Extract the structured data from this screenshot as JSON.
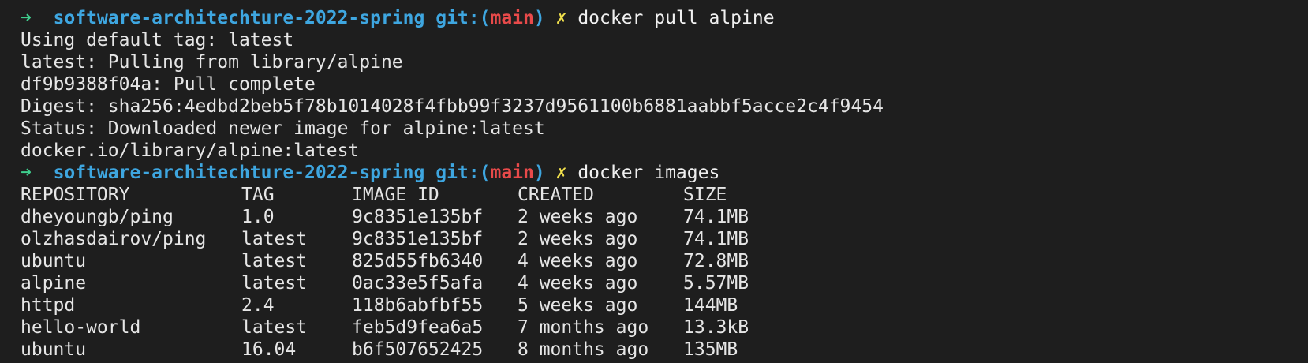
{
  "prompt1": {
    "arrow": "➜",
    "dir": "software-architechture-2022-spring",
    "git_open": "git:(",
    "branch": "main",
    "git_close": ")",
    "dirty": "✗",
    "command": "docker pull alpine"
  },
  "pull_output": [
    "Using default tag: latest",
    "latest: Pulling from library/alpine",
    "df9b9388f04a: Pull complete",
    "Digest: sha256:4edbd2beb5f78b1014028f4fbb99f3237d9561100b6881aabbf5acce2c4f9454",
    "Status: Downloaded newer image for alpine:latest",
    "docker.io/library/alpine:latest"
  ],
  "prompt2": {
    "arrow": "➜",
    "dir": "software-architechture-2022-spring",
    "git_open": "git:(",
    "branch": "main",
    "git_close": ")",
    "dirty": "✗",
    "command": "docker images"
  },
  "images_table": {
    "headers": [
      "REPOSITORY",
      "TAG",
      "IMAGE ID",
      "CREATED",
      "SIZE"
    ],
    "rows": [
      [
        "dheyoungb/ping",
        "1.0",
        "9c8351e135bf",
        "2 weeks ago",
        "74.1MB"
      ],
      [
        "olzhasdairov/ping",
        "latest",
        "9c8351e135bf",
        "2 weeks ago",
        "74.1MB"
      ],
      [
        "ubuntu",
        "latest",
        "825d55fb6340",
        "4 weeks ago",
        "72.8MB"
      ],
      [
        "alpine",
        "latest",
        "0ac33e5f5afa",
        "4 weeks ago",
        "5.57MB"
      ],
      [
        "httpd",
        "2.4",
        "118b6abfbf55",
        "5 weeks ago",
        "144MB"
      ],
      [
        "hello-world",
        "latest",
        "feb5d9fea6a5",
        "7 months ago",
        "13.3kB"
      ],
      [
        "ubuntu",
        "16.04",
        "b6f507652425",
        "8 months ago",
        "135MB"
      ]
    ]
  },
  "colors": {
    "background": "#1e1e1e",
    "prompt_arrow": "#3fcf8e",
    "prompt_dir": "#3ea6e0",
    "branch": "#e84a4a",
    "dirty_marker": "#f2e14c",
    "text": "#e6e6e6"
  }
}
